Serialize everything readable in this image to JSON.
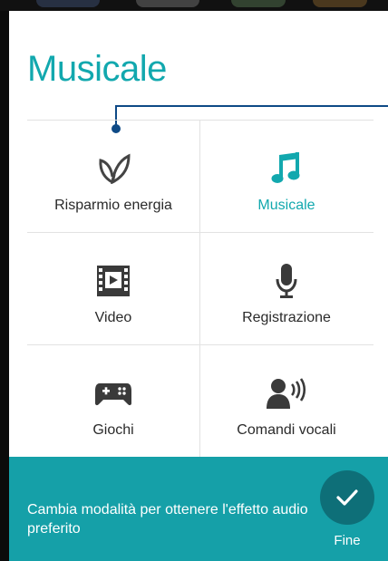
{
  "header": {
    "title": "Musicale"
  },
  "modes": [
    {
      "label": "Risparmio energia",
      "icon": "leaf-icon",
      "active": false
    },
    {
      "label": "Musicale",
      "icon": "music-note-icon",
      "active": true
    },
    {
      "label": "Video",
      "icon": "film-icon",
      "active": false
    },
    {
      "label": "Registrazione",
      "icon": "microphone-icon",
      "active": false
    },
    {
      "label": "Giochi",
      "icon": "gamepad-icon",
      "active": false
    },
    {
      "label": "Comandi vocali",
      "icon": "voice-command-icon",
      "active": false
    }
  ],
  "footer": {
    "hint": "Cambia modalità per ottenere l'effetto audio preferito",
    "done_label": "Fine"
  },
  "colors": {
    "accent": "#12a8ae",
    "footer_bg": "#15a0a8",
    "pointer": "#0e4a86"
  }
}
